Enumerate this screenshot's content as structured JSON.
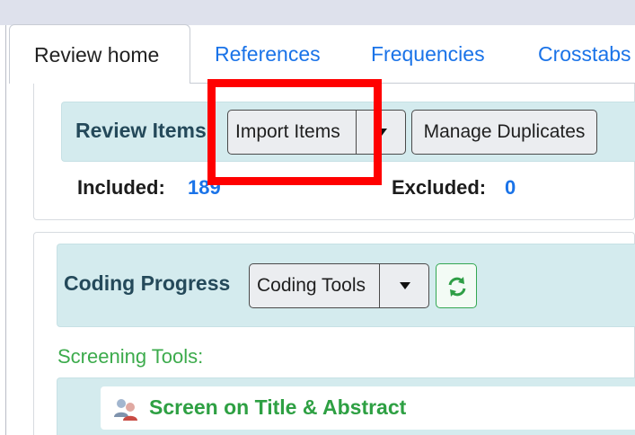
{
  "tabs": [
    {
      "label": "Review home",
      "active": true
    },
    {
      "label": "References"
    },
    {
      "label": "Frequencies"
    },
    {
      "label": "Crosstabs"
    }
  ],
  "review_items": {
    "title": "Review Items",
    "import_button": "Import Items",
    "manage_duplicates_button": "Manage Duplicates",
    "included_label": "Included:",
    "included_value": "189",
    "excluded_label": "Excluded:",
    "excluded_value": "0"
  },
  "coding_progress": {
    "title": "Coding Progress",
    "coding_tools_button": "Coding Tools",
    "refresh_icon": "refresh-icon"
  },
  "screening": {
    "label": "Screening Tools:",
    "item_label": "Screen on Title & Abstract",
    "item_icon": "users-icon"
  },
  "colors": {
    "link": "#1a73e8",
    "band": "#d4ebee",
    "title": "#24495a",
    "green": "#2ea043",
    "highlight": "#ff0000"
  }
}
